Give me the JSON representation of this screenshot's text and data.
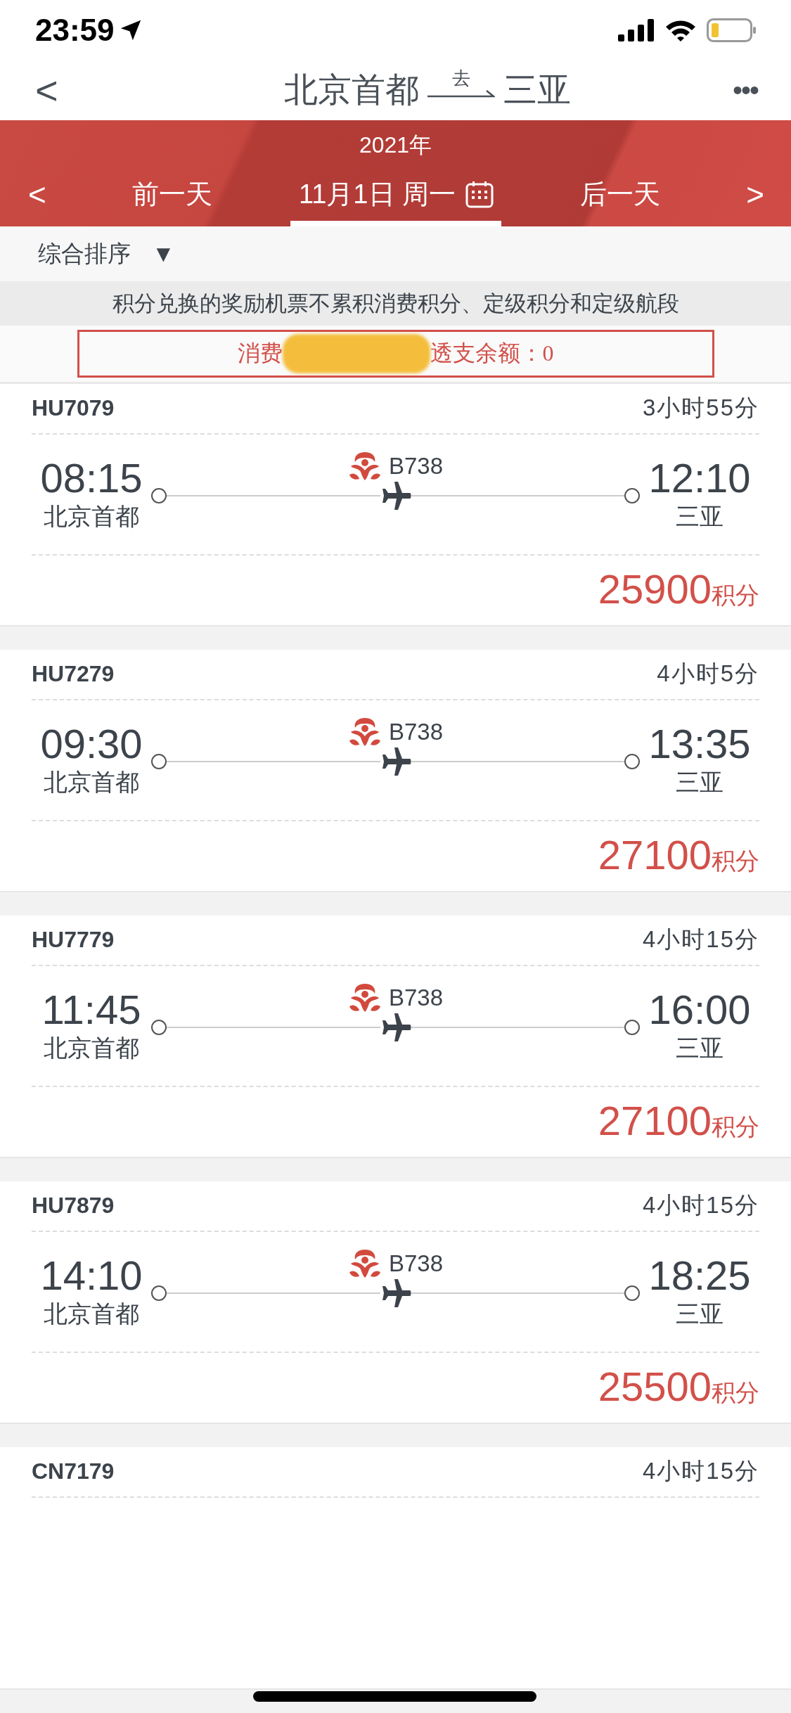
{
  "status_bar": {
    "time": "23:59"
  },
  "nav": {
    "back": "<",
    "from": "北京首都",
    "direction": "去",
    "to": "三亚",
    "more": "•••"
  },
  "date_bar": {
    "year": "2021年",
    "prev_arrow": "<",
    "prev": "前一天",
    "date": "11月1日 周一",
    "next": "后一天",
    "next_arrow": ">"
  },
  "sort": {
    "label": "综合排序",
    "caret": "▼"
  },
  "notice": "积分兑换的奖励机票不累积消费积分、定级积分和定级航段",
  "balance": {
    "visible_start": "消费",
    "visible_end": "透支余额：0"
  },
  "flights": [
    {
      "number": "HU7079",
      "duration": "3小时55分",
      "dep_time": "08:15",
      "dep_city": "北京首都",
      "aircraft": "B738",
      "arr_time": "12:10",
      "arr_city": "三亚",
      "price": "25900",
      "unit": "积分"
    },
    {
      "number": "HU7279",
      "duration": "4小时5分",
      "dep_time": "09:30",
      "dep_city": "北京首都",
      "aircraft": "B738",
      "arr_time": "13:35",
      "arr_city": "三亚",
      "price": "27100",
      "unit": "积分"
    },
    {
      "number": "HU7779",
      "duration": "4小时15分",
      "dep_time": "11:45",
      "dep_city": "北京首都",
      "aircraft": "B738",
      "arr_time": "16:00",
      "arr_city": "三亚",
      "price": "27100",
      "unit": "积分"
    },
    {
      "number": "HU7879",
      "duration": "4小时15分",
      "dep_time": "14:10",
      "dep_city": "北京首都",
      "aircraft": "B738",
      "arr_time": "18:25",
      "arr_city": "三亚",
      "price": "25500",
      "unit": "积分"
    },
    {
      "number": "CN7179",
      "duration": "4小时15分"
    }
  ]
}
